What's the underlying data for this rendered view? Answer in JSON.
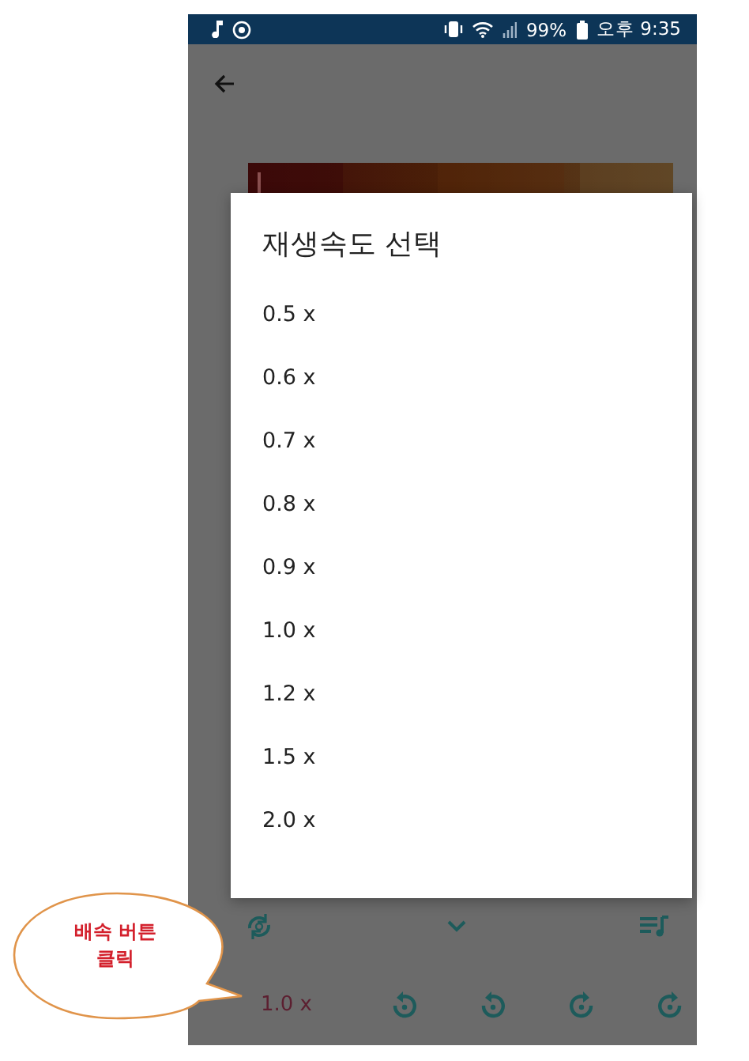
{
  "status_bar": {
    "battery": "99%",
    "time": "오후 9:35"
  },
  "player": {
    "speed_button": "1.0 x"
  },
  "dialog": {
    "title": "재생속도 선택",
    "options": [
      {
        "label": "0.5 x"
      },
      {
        "label": "0.6 x"
      },
      {
        "label": "0.7 x"
      },
      {
        "label": "0.8 x"
      },
      {
        "label": "0.9 x"
      },
      {
        "label": "1.0 x"
      },
      {
        "label": "1.2 x"
      },
      {
        "label": "1.5 x"
      },
      {
        "label": "2.0 x"
      }
    ]
  },
  "annotation": {
    "text": "배속 버튼\n클릭"
  }
}
